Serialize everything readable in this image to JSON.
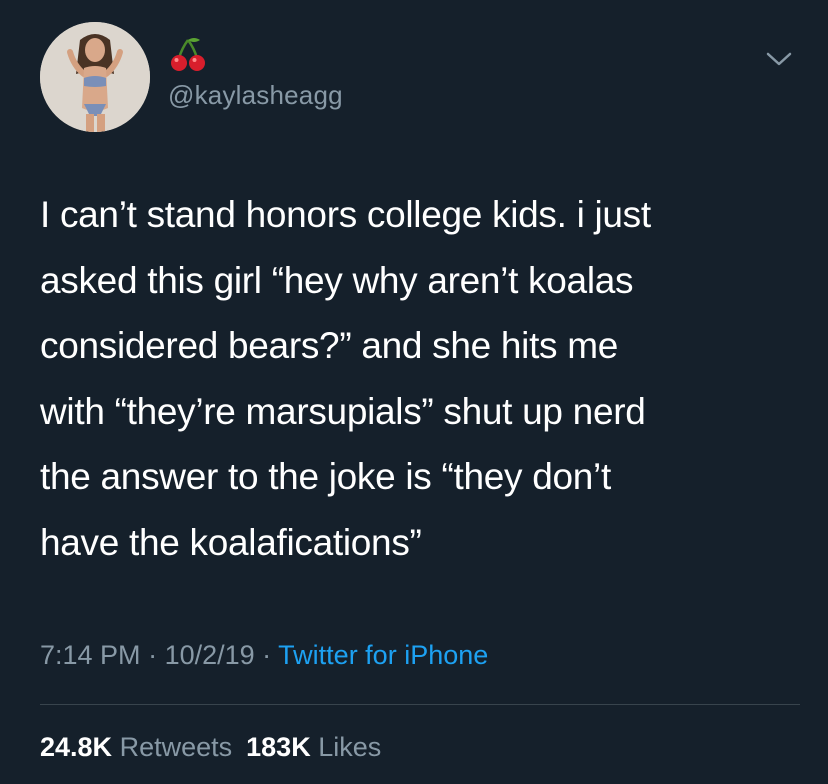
{
  "tweet": {
    "handle": "@kaylasheagg",
    "name_emoji": "cherry-icon",
    "text_lines": [
      "I can’t stand honors college kids. i just",
      "asked this girl “hey why aren’t koalas",
      "considered bears?” and she hits me",
      "with “they’re marsupials” shut up nerd",
      "the answer to the joke is “they don’t",
      "have the koalafications”"
    ],
    "time": "7:14 PM",
    "separator": " · ",
    "date": "10/2/19",
    "source": "Twitter for iPhone",
    "retweets_count": "24.8K",
    "retweets_label": "Retweets",
    "likes_count": "183K",
    "likes_label": "Likes"
  },
  "colors": {
    "background": "#15202b",
    "secondary_text": "#8899a6",
    "link": "#1da1f2",
    "divider": "#38444d",
    "cherry_red": "#d81e2c",
    "cherry_stem": "#4a8a2a"
  }
}
